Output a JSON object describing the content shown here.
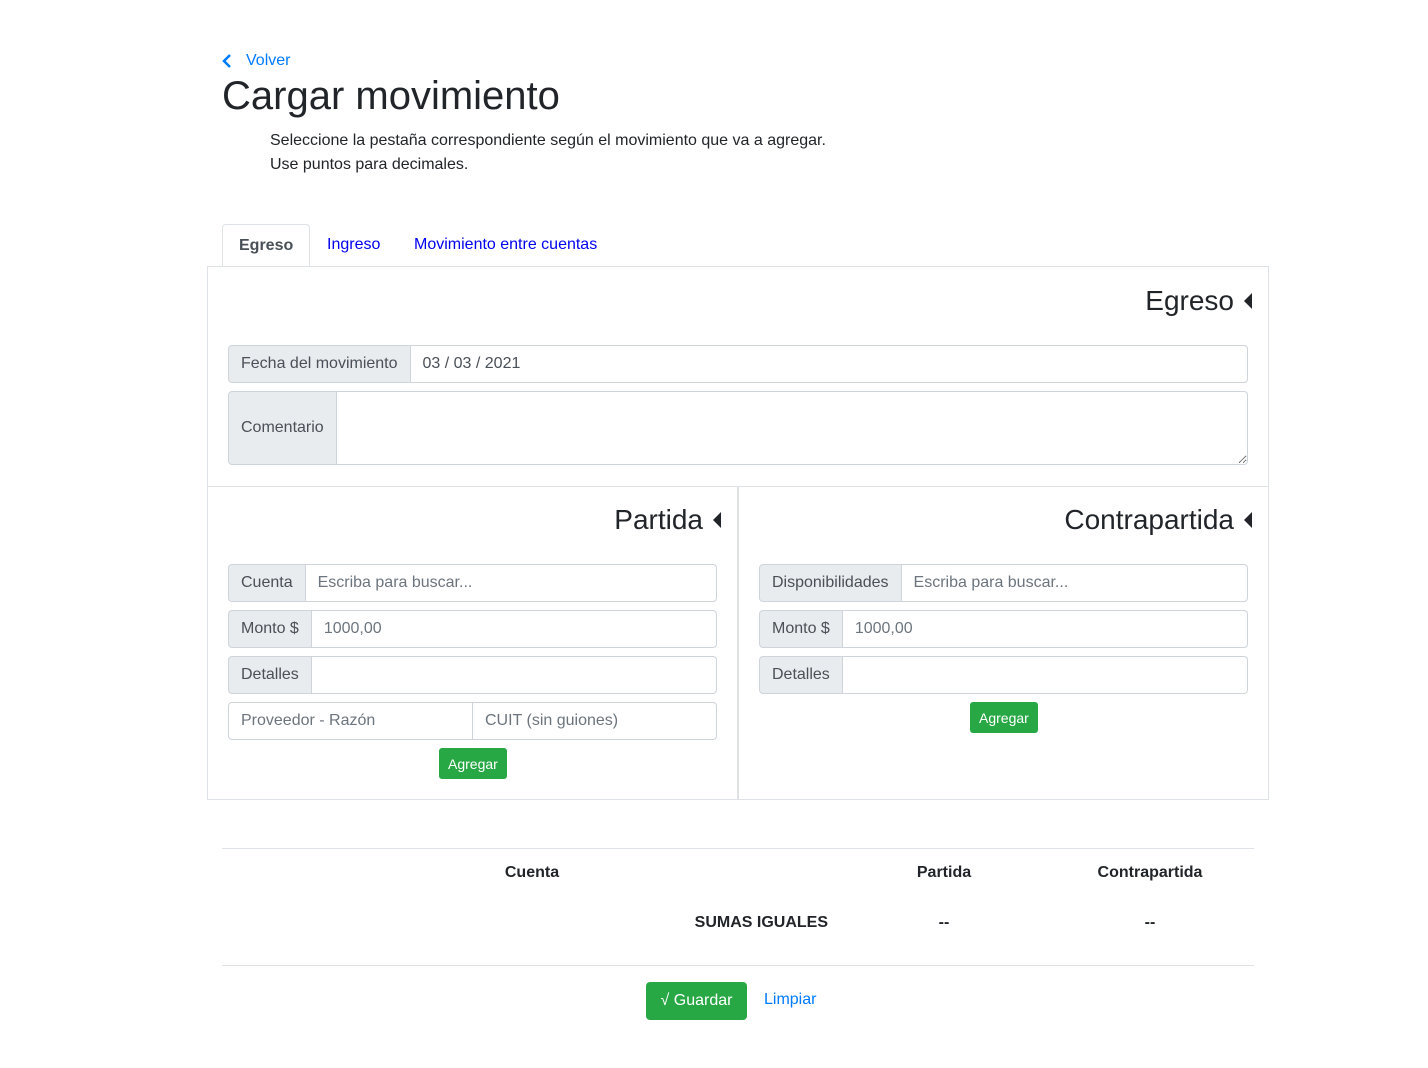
{
  "header": {
    "back_label": "Volver",
    "title": "Cargar movimiento",
    "instructions": [
      "Seleccione la pestaña correspondiente según el movimiento que va a agregar.",
      "Use puntos para decimales."
    ]
  },
  "tabs": [
    {
      "label": "Egreso",
      "active": true
    },
    {
      "label": "Ingreso",
      "active": false
    },
    {
      "label": "Movimiento entre cuentas",
      "active": false
    }
  ],
  "egreso": {
    "title": "Egreso",
    "fecha_label": "Fecha del movimiento",
    "fecha_value": "03 / 03 / 2021",
    "comentario_label": "Comentario",
    "comentario_value": ""
  },
  "partida": {
    "title": "Partida",
    "cuenta_label": "Cuenta",
    "cuenta_placeholder": "Escriba para buscar...",
    "monto_label": "Monto $",
    "monto_placeholder": "1000,00",
    "detalles_label": "Detalles",
    "proveedor_placeholder": "Proveedor - Razón",
    "cuit_placeholder": "CUIT (sin guiones)",
    "add_label": "Agregar"
  },
  "contrapartida": {
    "title": "Contrapartida",
    "disp_label": "Disponibilidades",
    "disp_placeholder": "Escriba para buscar...",
    "monto_label": "Monto $",
    "monto_placeholder": "1000,00",
    "detalles_label": "Detalles",
    "add_label": "Agregar"
  },
  "summary": {
    "headers": [
      "Cuenta",
      "Partida",
      "Contrapartida"
    ],
    "sumas_label": "SUMAS IGUALES",
    "partida_total": "--",
    "contrapartida_total": "--"
  },
  "actions": {
    "save_label": "√ Guardar",
    "clear_label": "Limpiar"
  },
  "colors": {
    "primary": "#007bff",
    "success": "#28a745",
    "border": "#dee2e6"
  }
}
